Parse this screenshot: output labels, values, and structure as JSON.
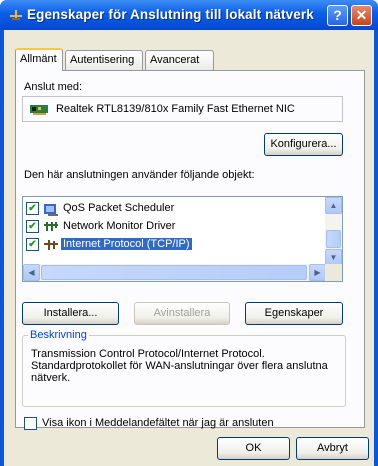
{
  "window": {
    "title": "Egenskaper för Anslutning till lokalt nätverk",
    "help_glyph": "?",
    "close_glyph": "✕"
  },
  "tabs": [
    {
      "label": "Allmänt",
      "active": true
    },
    {
      "label": "Autentisering",
      "active": false
    },
    {
      "label": "Avancerat",
      "active": false
    }
  ],
  "general": {
    "connect_using_label": "Anslut med:",
    "adapter_name": "Realtek RTL8139/810x Family Fast Ethernet NIC",
    "configure_label": "Konfigurera...",
    "items_label": "Den här anslutningen använder följande objekt:",
    "items": [
      {
        "label": "QoS Packet Scheduler",
        "checked": true,
        "icon": "qos-scheduler-icon",
        "selected": false
      },
      {
        "label": "Network Monitor Driver",
        "checked": true,
        "icon": "network-driver-icon",
        "selected": false
      },
      {
        "label": "Internet Protocol (TCP/IP)",
        "checked": true,
        "icon": "protocol-icon",
        "selected": true
      }
    ],
    "check_glyph": "✔",
    "install_label": "Installera...",
    "uninstall_label": "Avinstallera",
    "properties_label": "Egenskaper",
    "description_title": "Beskrivning",
    "description_text": "Transmission Control Protocol/Internet Protocol. Standardprotokollet för WAN-anslutningar över flera anslutna nätverk.",
    "show_icon_label": "Visa ikon i Meddelandefältet när jag är ansluten",
    "show_icon_checked": false
  },
  "footer": {
    "ok_label": "OK",
    "cancel_label": "Avbryt"
  },
  "scroll": {
    "up": "▲",
    "down": "▼",
    "left": "◀",
    "right": "▶"
  },
  "colors": {
    "title_bar": "#0a5ee8",
    "selection": "#316ac5",
    "tab_highlight": "#ffc83c",
    "group_title": "#0046d5"
  }
}
